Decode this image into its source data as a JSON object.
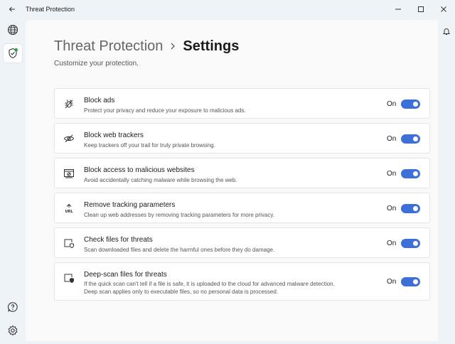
{
  "window": {
    "title": "Threat Protection",
    "back_icon": "back-arrow-icon",
    "controls": [
      "minimize-icon",
      "maximize-icon",
      "close-icon"
    ]
  },
  "sidebar": {
    "items": [
      {
        "icon": "globe-icon",
        "active": false
      },
      {
        "icon": "shield-check-icon",
        "active": true,
        "status_color": "#2ea043"
      }
    ],
    "bottom_items": [
      {
        "icon": "help-icon"
      },
      {
        "icon": "settings-gear-icon"
      }
    ]
  },
  "header": {
    "parent": "Threat Protection",
    "current": "Settings",
    "subtitle": "Customize your protection."
  },
  "settings": [
    {
      "title": "Block ads",
      "description": "Protect your privacy and reduce your exposure to malicious ads.",
      "state": "On",
      "icon": "bug-block-icon",
      "enabled": true
    },
    {
      "title": "Block web trackers",
      "description": "Keep trackers off your trail for truly private browsing.",
      "state": "On",
      "icon": "eye-slash-icon",
      "enabled": true
    },
    {
      "title": "Block access to malicious websites",
      "description": "Avoid accidentally catching malware while browsing the web.",
      "state": "On",
      "icon": "browser-block-icon",
      "enabled": true
    },
    {
      "title": "Remove tracking parameters",
      "description": "Clean up web addresses by removing tracking parameters for more privacy.",
      "state": "On",
      "icon": "url-clean-icon",
      "enabled": true
    },
    {
      "title": "Check files for threats",
      "description": "Scan downloaded files and delete the harmful ones before they do damage.",
      "state": "On",
      "icon": "file-shield-icon",
      "enabled": true
    },
    {
      "title": "Deep-scan files for threats",
      "description_lines": [
        "If the quick scan can't tell if a file is safe, it is uploaded to the cloud for advanced malware detection.",
        "Deep scan applies only to executable files, so no personal data is processed."
      ],
      "state": "On",
      "icon": "file-deep-scan-icon",
      "enabled": true
    }
  ],
  "colors": {
    "accent": "#3c6fd8",
    "background": "#eef3f8",
    "panel": "#f9f9f9"
  }
}
